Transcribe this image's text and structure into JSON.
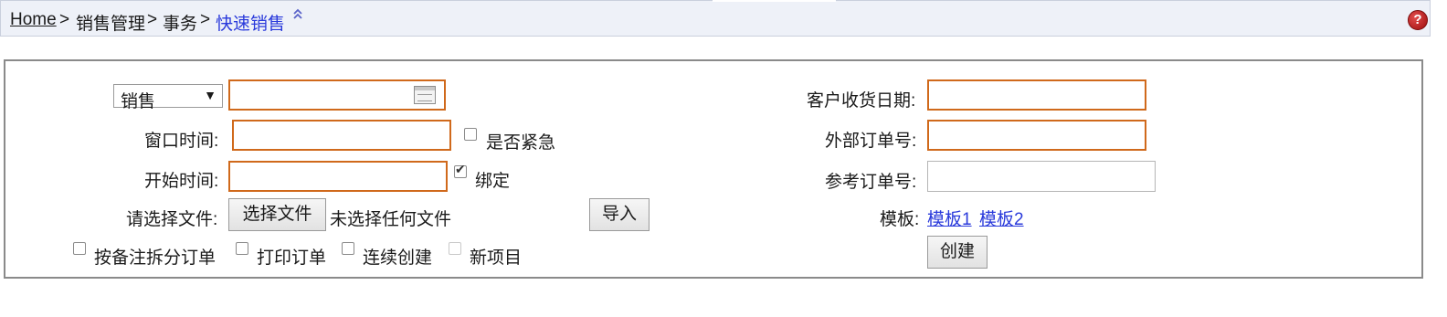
{
  "breadcrumb": {
    "items": [
      "Home",
      "销售管理",
      "事务"
    ],
    "separator": ">",
    "current": "快速销售"
  },
  "form": {
    "type_select": {
      "value": "销售"
    },
    "window_time": {
      "label": "窗口时间:",
      "value": ""
    },
    "urgent": {
      "label": "是否紧急",
      "checked": false
    },
    "start_time": {
      "label": "开始时间:",
      "value": ""
    },
    "bind": {
      "label": "绑定",
      "checked": true
    },
    "file": {
      "label": "请选择文件:",
      "button": "选择文件",
      "status": "未选择任何文件"
    },
    "import_button": "导入",
    "options": [
      {
        "label": "按备注拆分订单",
        "checked": false,
        "disabled": false
      },
      {
        "label": "打印订单",
        "checked": false,
        "disabled": false
      },
      {
        "label": "连续创建",
        "checked": false,
        "disabled": false
      },
      {
        "label": "新项目",
        "checked": false,
        "disabled": true
      }
    ],
    "customer_receipt_date": {
      "label": "客户收货日期:",
      "value": ""
    },
    "external_order_no": {
      "label": "外部订单号:",
      "value": ""
    },
    "reference_order_no": {
      "label": "参考订单号:",
      "value": ""
    },
    "template": {
      "label": "模板:",
      "links": [
        "模板1",
        "模板2"
      ]
    },
    "create_button": "创建"
  },
  "colors": {
    "required_border": "#d0691b",
    "link": "#2a3adb",
    "breadcrumb_bg": "#eef1f8"
  }
}
